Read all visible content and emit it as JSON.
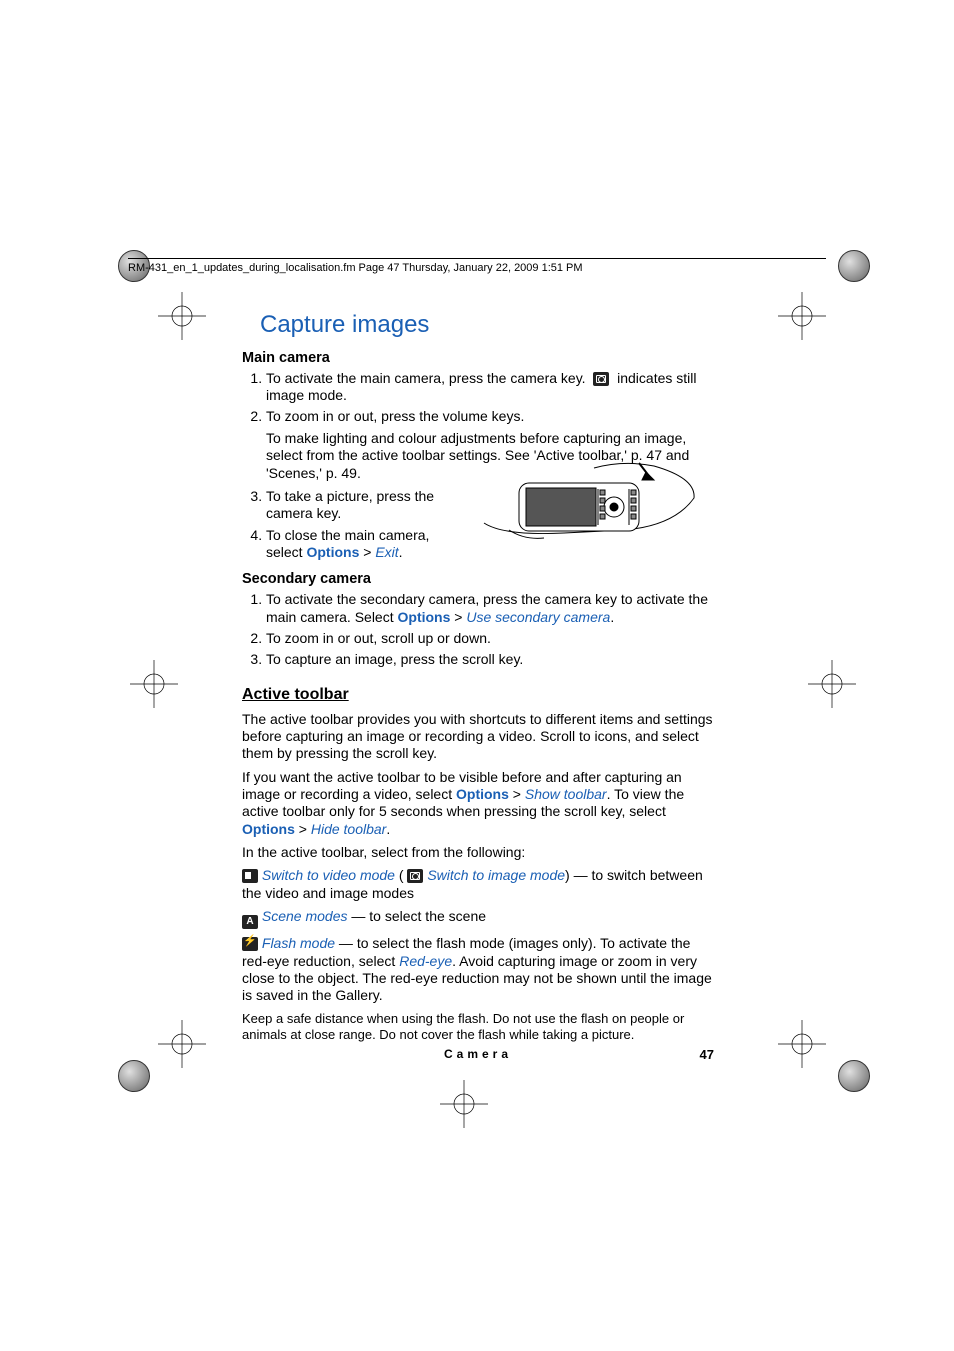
{
  "header": {
    "running_head": "RM-431_en_1_updates_during_localisation.fm  Page 47  Thursday, January 22, 2009  1:51 PM"
  },
  "section": {
    "title": "Capture images",
    "main_camera": {
      "heading": "Main camera",
      "step1_a": "To activate the main camera, press the camera key.",
      "step1_b": "indicates still image mode.",
      "step2": "To zoom in or out, press the volume keys.",
      "step2_sub": "To make lighting and colour adjustments before capturing an image, select from the active toolbar settings. See 'Active toolbar,' p. 47 and 'Scenes,' p. 49.",
      "step3": "To take a picture, press the camera key.",
      "step4_a": "To close the main camera, select ",
      "step4_opt": "Options",
      "step4_gt": " > ",
      "step4_exit": "Exit",
      "step4_end": "."
    },
    "secondary_camera": {
      "heading": "Secondary camera",
      "step1_a": "To activate the secondary camera, press the camera key to activate the main camera. Select ",
      "step1_opt": "Options",
      "step1_gt": " > ",
      "step1_cmd": "Use secondary camera",
      "step1_end": ".",
      "step2": "To zoom in or out, scroll up or down.",
      "step3": "To capture an image, press the scroll key."
    },
    "active_toolbar": {
      "heading": "Active toolbar",
      "p1": "The active toolbar provides you with shortcuts to different items and settings before capturing an image or recording a video. Scroll to icons, and select them by pressing the scroll key.",
      "p2_a": "If you want the active toolbar to be visible before and after capturing an image or recording a video, select ",
      "p2_opt1": "Options",
      "p2_gt1": " > ",
      "p2_cmd1": "Show toolbar",
      "p2_b": ". To view the active toolbar only for 5 seconds when pressing the scroll key, select ",
      "p2_opt2": "Options",
      "p2_gt2": " > ",
      "p2_cmd2": "Hide toolbar",
      "p2_end": ".",
      "p3": "In the active toolbar, select from the following:",
      "item1_a": "Switch to video mode",
      "item1_mid": " ( ",
      "item1_b": "Switch to image mode",
      "item1_c": ") — to switch between the video and image modes",
      "item2_a": "Scene modes",
      "item2_b": " — to select the scene",
      "item3_a": "Flash mode",
      "item3_b": " — to select the flash mode (images only). To activate the red-eye reduction, select ",
      "item3_c": "Red-eye",
      "item3_d": ". Avoid capturing image or zoom in very close to the object. The red-eye reduction may not be shown until the image is saved in the Gallery.",
      "p4": "Keep a safe distance when using the flash. Do not use the flash on people or animals at close range. Do not cover the flash while taking a picture."
    }
  },
  "footer": {
    "section_name": "Camera",
    "page_number": "47"
  }
}
